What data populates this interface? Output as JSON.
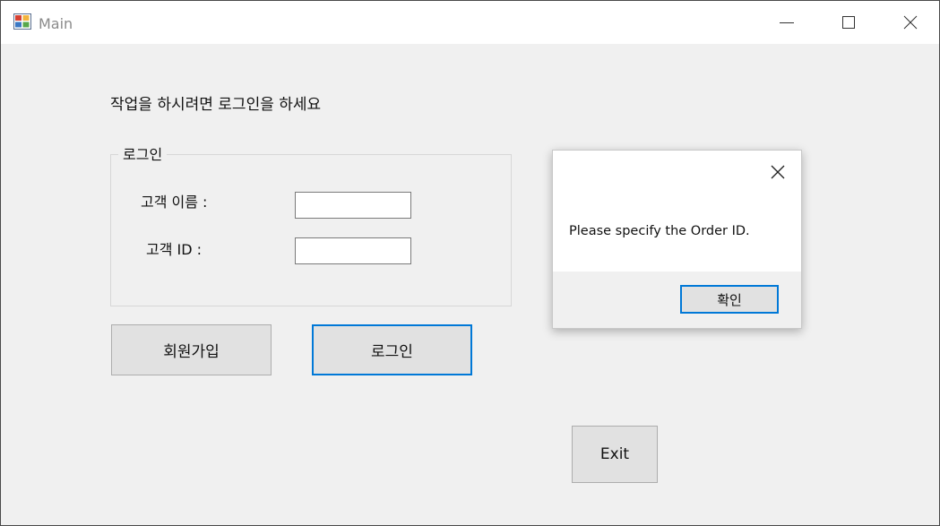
{
  "window": {
    "title": "Main",
    "controls": {
      "minimize": "minimize-icon",
      "maximize": "maximize-icon",
      "close": "close-icon"
    }
  },
  "main": {
    "instruction": "작업을 하시려면 로그인을 하세요",
    "login_group": {
      "title": "로그인",
      "name_label": "고객 이름 :",
      "name_value": "",
      "id_label": "고객 ID :",
      "id_value": ""
    },
    "register_button": "회원가입",
    "login_button": "로그인",
    "exit_button": "Exit"
  },
  "dialog": {
    "message": "Please specify the Order ID.",
    "ok_button": "확인"
  },
  "colors": {
    "accent": "#0078d7",
    "window_bg": "#f0f0f0",
    "button_bg": "#e1e1e1"
  }
}
